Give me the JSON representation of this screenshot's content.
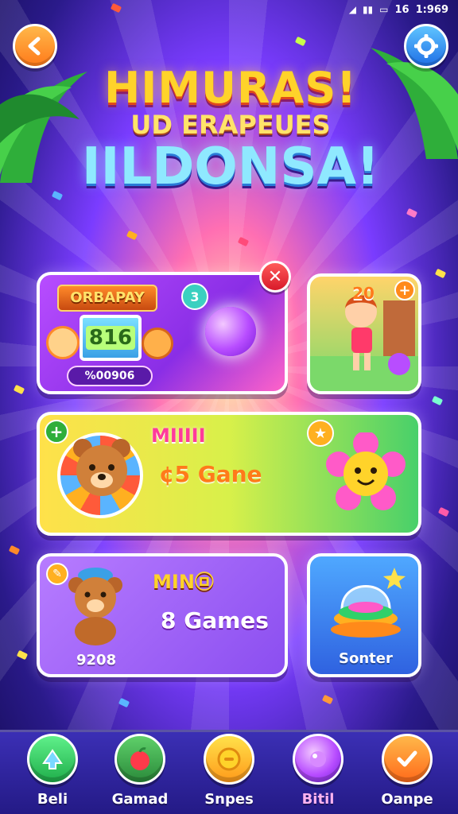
{
  "status_bar": {
    "battery_text": "16",
    "time": "1:969"
  },
  "title": {
    "line1": "HIMURAS!",
    "line2": "UD ERAPEUES",
    "line3": "IILDONSA!"
  },
  "card_top_left": {
    "banner": "ORBAPAY",
    "screen_value": "816",
    "badge": "3",
    "pill_text": "%00906"
  },
  "card_top_right": {
    "badge": "20",
    "plus": "+"
  },
  "card_middle": {
    "badge": "+",
    "title": "MIIIII",
    "subtitle": "¢5 Gane",
    "star_badge": "★"
  },
  "card_bottom_left": {
    "title": "MIN㉤",
    "subtitle": "8 Games",
    "footer": "9208"
  },
  "card_bottom_right": {
    "label": "Sonter"
  },
  "nav": {
    "items": [
      {
        "label": "Beli",
        "color": "#2fc46a"
      },
      {
        "label": "Gamad",
        "color": "#ff4a5a"
      },
      {
        "label": "Snpes",
        "color": "#ffb020"
      },
      {
        "label": "Bitil",
        "color": "#b84dff"
      },
      {
        "label": "Oanpe",
        "color": "#ff8a1a"
      }
    ],
    "active_index": 3
  },
  "colors": {
    "accent_pink": "#ff3a9a",
    "accent_orange": "#ff7a1a",
    "accent_blue": "#1f6fe6"
  }
}
